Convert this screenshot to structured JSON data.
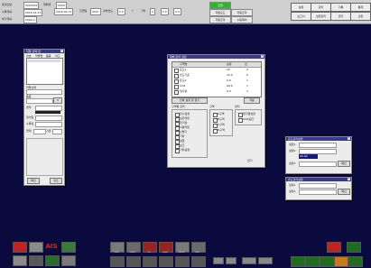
{
  "topbar": {
    "rows": [
      {
        "label": "총생산량",
        "value": "0001816",
        "label2": "재배계",
        "value2": "0000"
      },
      {
        "label": "수확계획",
        "value": "0016-02-13",
        "label2": "",
        "value2": ""
      },
      {
        "label": "부가계획",
        "value": "0000-0",
        "label2": "",
        "value2": ""
      }
    ],
    "mid_cells": [
      "2016-02-13",
      "진행일",
      "0007",
      "내부습도",
      "0.0",
      "Y",
      "기타",
      "0",
      "0.0",
      "0.0"
    ],
    "indicators": [
      "진행",
      "자동모드",
      "자동조작",
      "자동조작",
      "수동제어"
    ],
    "toolbar": [
      "설정",
      "관리",
      "기록",
      "통계",
      "보고서",
      "설정관리",
      "관리",
      "설정"
    ]
  },
  "win_left": {
    "title": "작물 선택 창",
    "list_header": [
      "번호",
      "작물명",
      "품종",
      "비고"
    ],
    "label_crop": "작물선택",
    "label_variety": "품종",
    "label_area": "면적",
    "label_plant": "정식일",
    "label_harvest": "수확일",
    "row_fields": [
      "현재",
      "기존",
      "품목",
      "재배",
      "설정"
    ],
    "ok_label": "확인",
    "cancel_label": "취소"
  },
  "win_center": {
    "title": "재배 관리 설정",
    "table_header": [
      "구역명",
      "설정",
      "값"
    ],
    "rows": [
      {
        "name": "온도1",
        "set": "22",
        "val": "0"
      },
      {
        "name": "습도기준",
        "set": "12.0",
        "val": "0"
      },
      {
        "name": "온도2",
        "set": "0.0",
        "val": "1"
      },
      {
        "name": "CO2",
        "set": "00.0",
        "val": "1"
      },
      {
        "name": "일사량",
        "set": "0.0",
        "val": "1"
      }
    ],
    "btn_a": "전체 설정 창 열기",
    "btn_b": "적용",
    "group1_title": "구역별 관리",
    "group1": [
      "관수설정",
      "보온커튼",
      "환기창",
      "차광커튼",
      "난방기",
      "기타",
      "창문",
      "보조",
      "기타설정"
    ],
    "group2_title": "구역",
    "group2": [
      "A구역",
      "B구역",
      "C구역",
      "D구역"
    ],
    "group3_title": "장치",
    "group3": [
      "환기팬설정",
      "CO2공급"
    ],
    "footer": "닫기"
  },
  "win_right1": {
    "title": "온도관리설정",
    "lines": [
      {
        "label": "설정1",
        "value": "0000"
      },
      {
        "label": "설정2",
        "value": "0000"
      },
      {
        "label": "설정3",
        "value": "0000"
      }
    ],
    "selected_value": "00.00",
    "btn": "확인"
  },
  "win_right2": {
    "title": "습도관리설정",
    "lines": [
      {
        "label": "설정1",
        "value": "0000"
      },
      {
        "label": "설정2",
        "value": "0000"
      }
    ],
    "btn": "확인"
  },
  "dock": {
    "left": [
      {
        "name": "graph",
        "label": "",
        "color": "#c02222"
      },
      {
        "name": "tools",
        "label": "",
        "color": "#8a8a8a"
      },
      {
        "name": "ais",
        "label": "AIS",
        "color": "#0a0a3e"
      },
      {
        "name": "chart",
        "label": "",
        "color": "#3a7a3a"
      },
      {
        "name": "monitor",
        "label": "",
        "color": "#8a8a8a"
      },
      {
        "name": "settings",
        "label": "",
        "color": "#5a5a5a"
      }
    ],
    "center": [
      {
        "name": "temp",
        "label": "TEMP",
        "color": "#7a7a7a"
      },
      {
        "name": "hum",
        "label": "HUMID",
        "color": "#6a6a6a"
      },
      {
        "name": "co2",
        "label": "CO2",
        "color": "#9a2222"
      },
      {
        "name": "light",
        "label": "LIGHT",
        "color": "#9a2222"
      },
      {
        "name": "water",
        "label": "WATER",
        "color": "#7a7a7a"
      },
      {
        "name": "info",
        "label": "INFO",
        "color": "#6a6a6a"
      }
    ],
    "right": [
      {
        "name": "r1",
        "label": "",
        "color": "#1f6b1f"
      },
      {
        "name": "r2",
        "label": "",
        "color": "#1f6b1f"
      },
      {
        "name": "r3",
        "label": "",
        "color": "#1f6b1f"
      },
      {
        "name": "r4",
        "label": "",
        "color": "#c77a1a"
      },
      {
        "name": "r5",
        "label": "",
        "color": "#1f6b1f"
      },
      {
        "name": "r6",
        "label": "",
        "color": "#c02222"
      },
      {
        "name": "r7",
        "label": "",
        "color": "#1f6b1f"
      }
    ],
    "mid_small": [
      "",
      "",
      "",
      ""
    ]
  }
}
